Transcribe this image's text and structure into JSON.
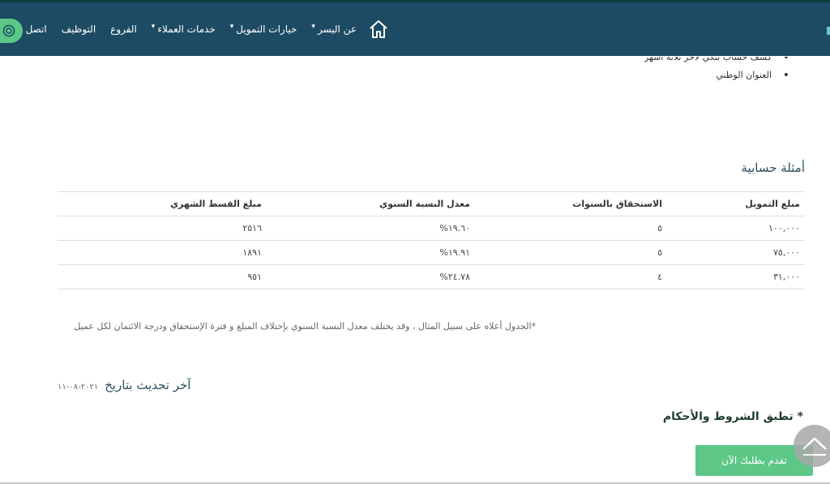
{
  "nav": {
    "items": [
      {
        "label": "عن اليسر",
        "has_dropdown": true
      },
      {
        "label": "خيارات التمويل",
        "has_dropdown": true
      },
      {
        "label": "خدمات العملاء",
        "has_dropdown": true
      },
      {
        "label": "الفروع",
        "has_dropdown": false
      },
      {
        "label": "التوظيف",
        "has_dropdown": false
      },
      {
        "label": "اتصل بنا",
        "has_dropdown": false
      }
    ],
    "home_icon": "home-icon",
    "right_button_icon": "chat-icon",
    "colors": {
      "bar": "#1c4b63",
      "accent": "#5cc786"
    }
  },
  "bullets": [
    "كشف حساب بنكي لآخر ثلاثة أشهر",
    "العنوان الوطني"
  ],
  "section_title": "أمثلة حسابية",
  "table": {
    "headers": [
      "مبلغ التمويل",
      "الاستحقاق بالسنوات",
      "معدل النسبة السنوي",
      "مبلغ القسط الشهري"
    ],
    "rows": [
      [
        "١٠٠,٠٠٠",
        "٥",
        "١٩.٦٠%",
        "٢٥١٦"
      ],
      [
        "٧٥,٠٠٠",
        "٥",
        "١٩.٩١%",
        "١٨٩١"
      ],
      [
        "٣١,٠٠٠",
        "٤",
        "٢٤.٧٨%",
        "٩٥١"
      ]
    ]
  },
  "note": "*الجدول أعلاه على سبيل المثال ، وقد يختلف معدل النسبة السنوي بإختلاف المبلغ و فترة الإستحقاق ودرجة الائتمان لكل عميل",
  "last_update": {
    "label": "آخر تحديث بتاريخ",
    "date": "٢٠٢١-٠٨-١١"
  },
  "terms": "* تطبق الشروط والأحكام",
  "apply_button": "تقدم بطلبك الآن"
}
